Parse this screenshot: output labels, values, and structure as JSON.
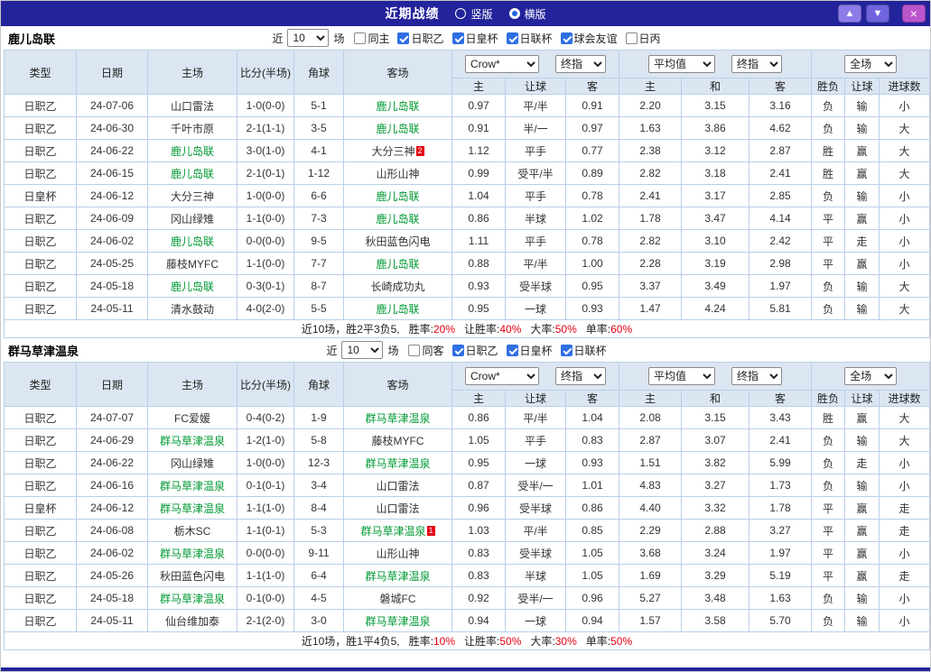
{
  "titlebar": {
    "title": "近期战绩",
    "layout_options": [
      {
        "label": "竖版",
        "selected": false
      },
      {
        "label": "横版",
        "selected": true
      }
    ],
    "window_buttons": {
      "up": "▲",
      "down": "▼",
      "close": "×"
    }
  },
  "colors": {
    "titlebar_bg": "#23239b",
    "header_bg": "#dce6f2",
    "grid_border": "#b9cfe8",
    "badge_green_bg": "#2cb88a",
    "badge_black_bg": "#000000",
    "focus_team": "#009933",
    "score_red": "#e60012",
    "result_red": "#e60012",
    "result_green": "#009933",
    "result_orange": "#cc8800",
    "check_blue": "#2f6fe4",
    "btn_up_bg": "#8d7ce8",
    "btn_down_bg": "#6f64dd",
    "btn_close_bg": "#bb55cc"
  },
  "result_color_map": {
    "胜": "red",
    "负": "red",
    "平": "green",
    "走": "orange",
    "赢": "red",
    "输": "red",
    "大": "red",
    "小": "red"
  },
  "filter_labels": {
    "near": "近",
    "count": "10",
    "games": "场"
  },
  "table_header": {
    "left_columns": [
      "类型",
      "日期",
      "主场",
      "比分(半场)",
      "角球",
      "客场"
    ],
    "group1": {
      "selects": [
        "Crow*",
        "终指"
      ],
      "sub": [
        "主",
        "让球",
        "客"
      ]
    },
    "group2": {
      "selects": [
        "平均值",
        "终指"
      ],
      "sub": [
        "主",
        "和",
        "客"
      ]
    },
    "group3": {
      "selects": [
        "全场"
      ],
      "sub": [
        "胜负",
        "让球",
        "进球数"
      ]
    }
  },
  "sections": [
    {
      "team": "鹿儿岛联",
      "filters": [
        {
          "label": "同主",
          "checked": false
        },
        {
          "label": "日职乙",
          "checked": true
        },
        {
          "label": "日皇杯",
          "checked": true
        },
        {
          "label": "日联杯",
          "checked": true
        },
        {
          "label": "球会友谊",
          "checked": true
        },
        {
          "label": "日丙",
          "checked": false
        }
      ],
      "rows": [
        {
          "league": "日职乙",
          "league_style": "green",
          "date": "24-07-06",
          "home": "山口雷法",
          "home_focus": false,
          "home_badge": "",
          "score": "1-0(0-0)",
          "corners": "5-1",
          "away": "鹿儿岛联",
          "away_focus": true,
          "away_badge": "",
          "odds": [
            "0.97",
            "平/半",
            "0.91"
          ],
          "avg": [
            "2.20",
            "3.15",
            "3.16"
          ],
          "results": [
            "负",
            "输",
            "小"
          ]
        },
        {
          "league": "日职乙",
          "league_style": "green",
          "date": "24-06-30",
          "home": "千叶市原",
          "home_focus": false,
          "home_badge": "",
          "score": "2-1(1-1)",
          "corners": "3-5",
          "away": "鹿儿岛联",
          "away_focus": true,
          "away_badge": "",
          "odds": [
            "0.91",
            "半/一",
            "0.97"
          ],
          "avg": [
            "1.63",
            "3.86",
            "4.62"
          ],
          "results": [
            "负",
            "输",
            "大"
          ]
        },
        {
          "league": "日职乙",
          "league_style": "green",
          "date": "24-06-22",
          "home": "鹿儿岛联",
          "home_focus": true,
          "home_badge": "",
          "score": "3-0(1-0)",
          "corners": "4-1",
          "away": "大分三神",
          "away_focus": false,
          "away_badge": "2",
          "odds": [
            "1.12",
            "平手",
            "0.77"
          ],
          "avg": [
            "2.38",
            "3.12",
            "2.87"
          ],
          "results": [
            "胜",
            "赢",
            "大"
          ]
        },
        {
          "league": "日职乙",
          "league_style": "green",
          "date": "24-06-15",
          "home": "鹿儿岛联",
          "home_focus": true,
          "home_badge": "",
          "score": "2-1(0-1)",
          "corners": "1-12",
          "away": "山形山神",
          "away_focus": false,
          "away_badge": "",
          "odds": [
            "0.99",
            "受平/半",
            "0.89"
          ],
          "avg": [
            "2.82",
            "3.18",
            "2.41"
          ],
          "results": [
            "胜",
            "赢",
            "大"
          ]
        },
        {
          "league": "日皇杯",
          "league_style": "black",
          "date": "24-06-12",
          "home": "大分三神",
          "home_focus": false,
          "home_badge": "",
          "score": "1-0(0-0)",
          "corners": "6-6",
          "away": "鹿儿岛联",
          "away_focus": true,
          "away_badge": "",
          "odds": [
            "1.04",
            "平手",
            "0.78"
          ],
          "avg": [
            "2.41",
            "3.17",
            "2.85"
          ],
          "results": [
            "负",
            "输",
            "小"
          ]
        },
        {
          "league": "日职乙",
          "league_style": "green",
          "date": "24-06-09",
          "home": "冈山绿雉",
          "home_focus": false,
          "home_badge": "",
          "score": "1-1(0-0)",
          "corners": "7-3",
          "away": "鹿儿岛联",
          "away_focus": true,
          "away_badge": "",
          "odds": [
            "0.86",
            "半球",
            "1.02"
          ],
          "avg": [
            "1.78",
            "3.47",
            "4.14"
          ],
          "results": [
            "平",
            "赢",
            "小"
          ]
        },
        {
          "league": "日职乙",
          "league_style": "green",
          "date": "24-06-02",
          "home": "鹿儿岛联",
          "home_focus": true,
          "home_badge": "",
          "score": "0-0(0-0)",
          "corners": "9-5",
          "away": "秋田蓝色闪电",
          "away_focus": false,
          "away_badge": "",
          "odds": [
            "1.11",
            "平手",
            "0.78"
          ],
          "avg": [
            "2.82",
            "3.10",
            "2.42"
          ],
          "results": [
            "平",
            "走",
            "小"
          ]
        },
        {
          "league": "日职乙",
          "league_style": "green",
          "date": "24-05-25",
          "home": "藤枝MYFC",
          "home_focus": false,
          "home_badge": "",
          "score": "1-1(0-0)",
          "corners": "7-7",
          "away": "鹿儿岛联",
          "away_focus": true,
          "away_badge": "",
          "odds": [
            "0.88",
            "平/半",
            "1.00"
          ],
          "avg": [
            "2.28",
            "3.19",
            "2.98"
          ],
          "results": [
            "平",
            "赢",
            "小"
          ]
        },
        {
          "league": "日职乙",
          "league_style": "green",
          "date": "24-05-18",
          "home": "鹿儿岛联",
          "home_focus": true,
          "home_badge": "",
          "score": "0-3(0-1)",
          "corners": "8-7",
          "away": "长崎成功丸",
          "away_focus": false,
          "away_badge": "",
          "odds": [
            "0.93",
            "受半球",
            "0.95"
          ],
          "avg": [
            "3.37",
            "3.49",
            "1.97"
          ],
          "results": [
            "负",
            "输",
            "大"
          ]
        },
        {
          "league": "日职乙",
          "league_style": "green",
          "date": "24-05-11",
          "home": "清水鼓动",
          "home_focus": false,
          "home_badge": "",
          "score": "4-0(2-0)",
          "corners": "5-5",
          "away": "鹿儿岛联",
          "away_focus": true,
          "away_badge": "",
          "odds": [
            "0.95",
            "一球",
            "0.93"
          ],
          "avg": [
            "1.47",
            "4.24",
            "5.81"
          ],
          "results": [
            "负",
            "输",
            "大"
          ]
        }
      ],
      "summary": {
        "prefix": "近10场，胜2平3负5,",
        "stats": [
          {
            "label": "胜率:",
            "value": "20%"
          },
          {
            "label": "让胜率:",
            "value": "40%"
          },
          {
            "label": "大率:",
            "value": "50%"
          },
          {
            "label": "单率:",
            "value": "60%"
          }
        ]
      }
    },
    {
      "team": "群马草津温泉",
      "filters": [
        {
          "label": "同客",
          "checked": false
        },
        {
          "label": "日职乙",
          "checked": true
        },
        {
          "label": "日皇杯",
          "checked": true
        },
        {
          "label": "日联杯",
          "checked": true
        }
      ],
      "rows": [
        {
          "league": "日职乙",
          "league_style": "green",
          "date": "24-07-07",
          "home": "FC爱媛",
          "home_focus": false,
          "home_badge": "",
          "score": "0-4(0-2)",
          "corners": "1-9",
          "away": "群马草津温泉",
          "away_focus": true,
          "away_badge": "",
          "odds": [
            "0.86",
            "平/半",
            "1.04"
          ],
          "avg": [
            "2.08",
            "3.15",
            "3.43"
          ],
          "results": [
            "胜",
            "赢",
            "大"
          ]
        },
        {
          "league": "日职乙",
          "league_style": "green",
          "date": "24-06-29",
          "home": "群马草津温泉",
          "home_focus": true,
          "home_badge": "",
          "score": "1-2(1-0)",
          "corners": "5-8",
          "away": "藤枝MYFC",
          "away_focus": false,
          "away_badge": "",
          "odds": [
            "1.05",
            "平手",
            "0.83"
          ],
          "avg": [
            "2.87",
            "3.07",
            "2.41"
          ],
          "results": [
            "负",
            "输",
            "大"
          ]
        },
        {
          "league": "日职乙",
          "league_style": "green",
          "date": "24-06-22",
          "home": "冈山绿雉",
          "home_focus": false,
          "home_badge": "",
          "score": "1-0(0-0)",
          "corners": "12-3",
          "away": "群马草津温泉",
          "away_focus": true,
          "away_badge": "",
          "odds": [
            "0.95",
            "一球",
            "0.93"
          ],
          "avg": [
            "1.51",
            "3.82",
            "5.99"
          ],
          "results": [
            "负",
            "走",
            "小"
          ]
        },
        {
          "league": "日职乙",
          "league_style": "green",
          "date": "24-06-16",
          "home": "群马草津温泉",
          "home_focus": true,
          "home_badge": "",
          "score": "0-1(0-1)",
          "corners": "3-4",
          "away": "山口雷法",
          "away_focus": false,
          "away_badge": "",
          "odds": [
            "0.87",
            "受半/一",
            "1.01"
          ],
          "avg": [
            "4.83",
            "3.27",
            "1.73"
          ],
          "results": [
            "负",
            "输",
            "小"
          ]
        },
        {
          "league": "日皇杯",
          "league_style": "black",
          "date": "24-06-12",
          "home": "群马草津温泉",
          "home_focus": true,
          "home_badge": "",
          "score": "1-1(1-0)",
          "corners": "8-4",
          "away": "山口雷法",
          "away_focus": false,
          "away_badge": "",
          "odds": [
            "0.96",
            "受半球",
            "0.86"
          ],
          "avg": [
            "4.40",
            "3.32",
            "1.78"
          ],
          "results": [
            "平",
            "赢",
            "走"
          ]
        },
        {
          "league": "日职乙",
          "league_style": "green",
          "date": "24-06-08",
          "home": "栃木SC",
          "home_focus": false,
          "home_badge": "",
          "score": "1-1(0-1)",
          "corners": "5-3",
          "away": "群马草津温泉",
          "away_focus": true,
          "away_badge": "1",
          "odds": [
            "1.03",
            "平/半",
            "0.85"
          ],
          "avg": [
            "2.29",
            "2.88",
            "3.27"
          ],
          "results": [
            "平",
            "赢",
            "走"
          ]
        },
        {
          "league": "日职乙",
          "league_style": "green",
          "date": "24-06-02",
          "home": "群马草津温泉",
          "home_focus": true,
          "home_badge": "",
          "score": "0-0(0-0)",
          "corners": "9-11",
          "away": "山形山神",
          "away_focus": false,
          "away_badge": "",
          "odds": [
            "0.83",
            "受半球",
            "1.05"
          ],
          "avg": [
            "3.68",
            "3.24",
            "1.97"
          ],
          "results": [
            "平",
            "赢",
            "小"
          ]
        },
        {
          "league": "日职乙",
          "league_style": "green",
          "date": "24-05-26",
          "home": "秋田蓝色闪电",
          "home_focus": false,
          "home_badge": "",
          "score": "1-1(1-0)",
          "corners": "6-4",
          "away": "群马草津温泉",
          "away_focus": true,
          "away_badge": "",
          "odds": [
            "0.83",
            "半球",
            "1.05"
          ],
          "avg": [
            "1.69",
            "3.29",
            "5.19"
          ],
          "results": [
            "平",
            "赢",
            "走"
          ]
        },
        {
          "league": "日职乙",
          "league_style": "green",
          "date": "24-05-18",
          "home": "群马草津温泉",
          "home_focus": true,
          "home_badge": "",
          "score": "0-1(0-0)",
          "corners": "4-5",
          "away": "磐城FC",
          "away_focus": false,
          "away_badge": "",
          "odds": [
            "0.92",
            "受半/一",
            "0.96"
          ],
          "avg": [
            "5.27",
            "3.48",
            "1.63"
          ],
          "results": [
            "负",
            "输",
            "小"
          ]
        },
        {
          "league": "日职乙",
          "league_style": "green",
          "date": "24-05-11",
          "home": "仙台维加泰",
          "home_focus": false,
          "home_badge": "",
          "score": "2-1(2-0)",
          "corners": "3-0",
          "away": "群马草津温泉",
          "away_focus": true,
          "away_badge": "",
          "odds": [
            "0.94",
            "一球",
            "0.94"
          ],
          "avg": [
            "1.57",
            "3.58",
            "5.70"
          ],
          "results": [
            "负",
            "输",
            "小"
          ]
        }
      ],
      "summary": {
        "prefix": "近10场，胜1平4负5,",
        "stats": [
          {
            "label": "胜率:",
            "value": "10%"
          },
          {
            "label": "让胜率:",
            "value": "50%"
          },
          {
            "label": "大率:",
            "value": "30%"
          },
          {
            "label": "单率:",
            "value": "50%"
          }
        ]
      }
    }
  ]
}
